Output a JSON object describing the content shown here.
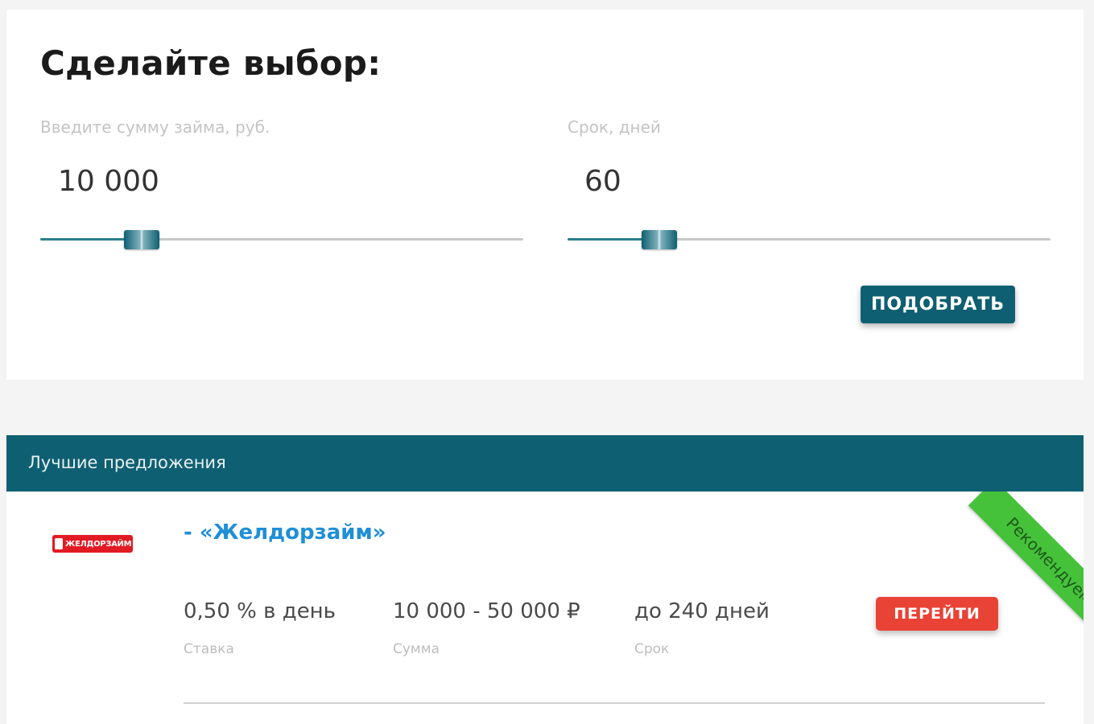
{
  "filter": {
    "title": "Сделайте выбор:",
    "amount": {
      "label": "Введите сумму займа, руб.",
      "value": "10 000",
      "slider_level": 0.21
    },
    "term": {
      "label": "Срок, дней",
      "value": "60",
      "slider_level": 0.19
    },
    "submit_label": "ПОДОБРАТЬ"
  },
  "offers": {
    "header_title": "Лучшие предложения",
    "items": [
      {
        "logo_text": "ЖЕЛДОРЗАЙМ",
        "name": "- «Желдорзайм»",
        "ribbon": "Рекомендуем",
        "rate": {
          "value": "0,50 % в день",
          "caption": "Ставка"
        },
        "amount": {
          "value": "10 000 - 50 000 ₽",
          "caption": "Сумма"
        },
        "term": {
          "value": "до 240 дней",
          "caption": "Срок"
        },
        "action_label": "ПЕРЕЙТИ"
      }
    ]
  },
  "colors": {
    "primary": "#0f5f72",
    "accent_red": "#e94336",
    "ribbon_green": "#45c23a",
    "link_blue": "#1f8fd6"
  }
}
